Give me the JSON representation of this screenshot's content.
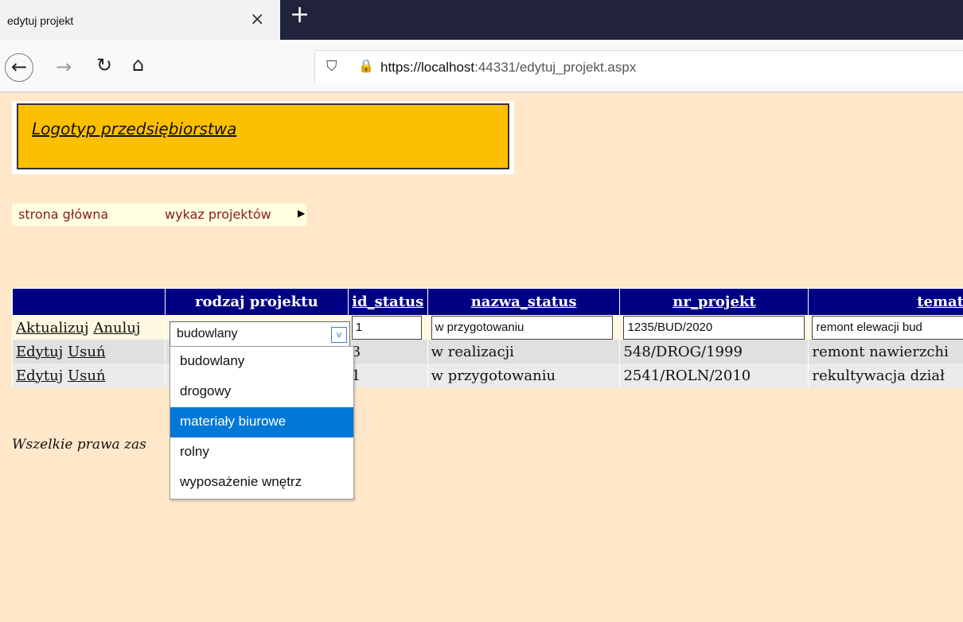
{
  "browser": {
    "tab_title": "edytuj projekt",
    "close_glyph": "×",
    "new_tab_glyph": "+",
    "url_host": "https://localhost",
    "url_rest": ":44331/edytuj_projekt.aspx"
  },
  "page": {
    "logo": "Logotyp przedsiębiorstwa",
    "menu": [
      "strona główna",
      "wykaz projektów"
    ],
    "footer": "Wszelkie prawa zas"
  },
  "table": {
    "headers": [
      "",
      "rodzaj projektu",
      "id_status",
      "nazwa_status",
      "nr_projekt",
      "temat_"
    ],
    "edit_row": {
      "actions": [
        "Aktualizuj",
        "Anuluj"
      ],
      "rodzaj": "budowlany",
      "id_status": "1",
      "nazwa_status": "w przygotowaniu",
      "nr_projekt": "1235/BUD/2020",
      "temat": "remont elewacji bud"
    },
    "rows": [
      {
        "actions": [
          "Edytuj",
          "Usuń"
        ],
        "id_status": "3",
        "nazwa_status": "w realizacji",
        "nr_projekt": "548/DROG/1999",
        "temat": "remont nawierzchi"
      },
      {
        "actions": [
          "Edytuj",
          "Usuń"
        ],
        "id_status": "1",
        "nazwa_status": "w przygotowaniu",
        "nr_projekt": "2541/ROLN/2010",
        "temat": "rekultywacja dział"
      }
    ]
  },
  "dropdown": {
    "options": [
      "budowlany",
      "drogowy",
      "materiały biurowe",
      "rolny",
      "wyposażenie wnętrz"
    ],
    "highlighted": "materiały biurowe"
  },
  "colors": {
    "page_bg": "#ffe8c9",
    "header_bg": "#000084",
    "logo_bg": "#fcc000",
    "menu_text": "#8b1a1a",
    "highlight": "#0078d7"
  }
}
